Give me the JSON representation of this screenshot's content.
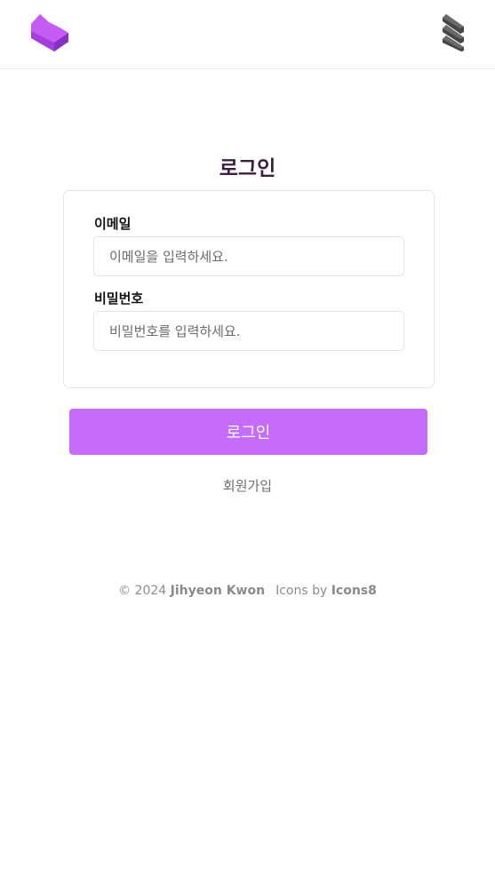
{
  "header": {
    "logo_icon": "heart-logo-icon",
    "menu_icon": "menu-icon",
    "logo_colors": {
      "top": "#c154f2",
      "side": "#8a2fc4",
      "bottom": "#a43edc"
    }
  },
  "login": {
    "title": "로그인",
    "email_label": "이메일",
    "email_placeholder": "이메일을 입력하세요.",
    "password_label": "비밀번호",
    "password_placeholder": "비밀번호를 입력하세요.",
    "submit_label": "로그인",
    "signup_label": "회원가입"
  },
  "footer": {
    "copyright_prefix": "© 2024",
    "author": "Jihyeon Kwon",
    "icons_prefix": "Icons by",
    "icons_source": "Icons8"
  },
  "colors": {
    "accent": "#c56cfc",
    "title": "#3a1f3e",
    "muted_text": "#6d6d6d"
  }
}
